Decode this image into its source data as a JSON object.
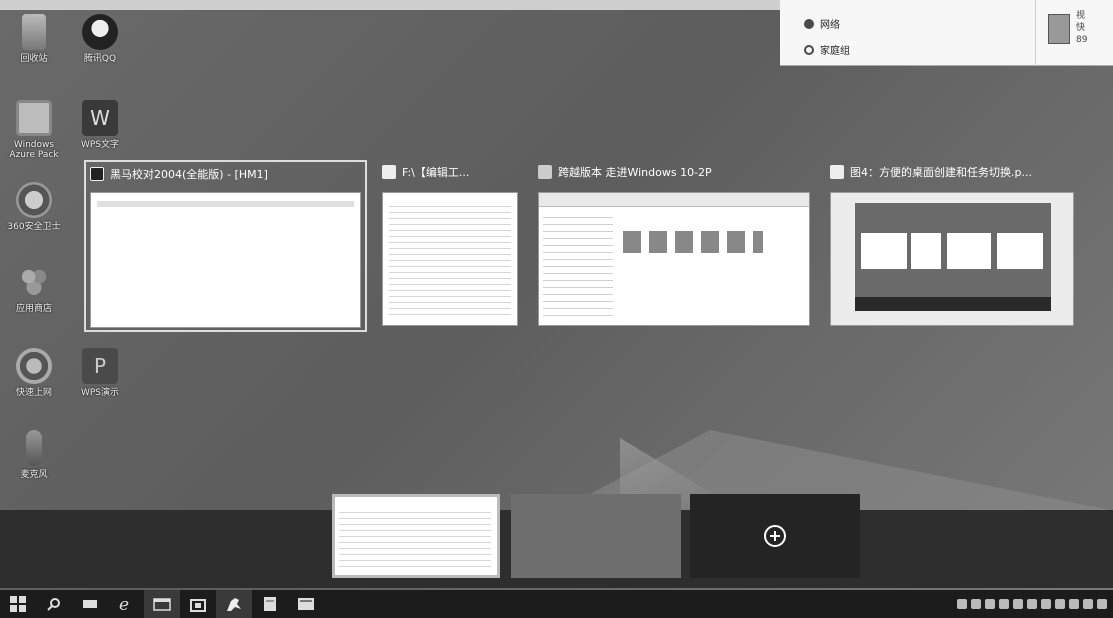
{
  "popup": {
    "items": [
      {
        "label": "网络",
        "icon": "network-icon"
      },
      {
        "label": "家庭组",
        "icon": "homegroup-icon"
      }
    ],
    "file_text": [
      "视",
      "快",
      "89"
    ]
  },
  "desktop_icons": [
    {
      "label": "回收站",
      "icon": "recycle-bin-icon"
    },
    {
      "label": "腾讯QQ",
      "icon": "qq-icon"
    },
    {
      "label": "Windows Azure Pack",
      "icon": "app-icon"
    },
    {
      "label": "WPS文字",
      "icon": "wps-icon"
    },
    {
      "label": "360安全卫士",
      "icon": "security-icon"
    },
    {
      "label": "应用商店",
      "icon": "store-icon"
    },
    {
      "label": "快速上网",
      "icon": "network-tool-icon"
    },
    {
      "label": "WPS演示",
      "icon": "wps-show-icon"
    },
    {
      "label": "麦克风",
      "icon": "microphone-icon"
    }
  ],
  "task_view": {
    "windows": [
      {
        "title": "黑马校对2004(全能版) - [HM1]"
      },
      {
        "title": "F:\\【编辑工..."
      },
      {
        "title": "跨越版本 走进Windows 10-2P"
      },
      {
        "title": "图4：方便的桌面创建和任务切换.p..."
      }
    ]
  },
  "virtual_desktops": {
    "add_label": "新建桌面"
  },
  "taskbar": {
    "buttons": [
      "start-icon",
      "search-icon",
      "task-view-icon",
      "ie-icon",
      "explorer-icon",
      "store-icon",
      "heima-icon",
      "notepad-icon",
      "photos-icon"
    ]
  }
}
